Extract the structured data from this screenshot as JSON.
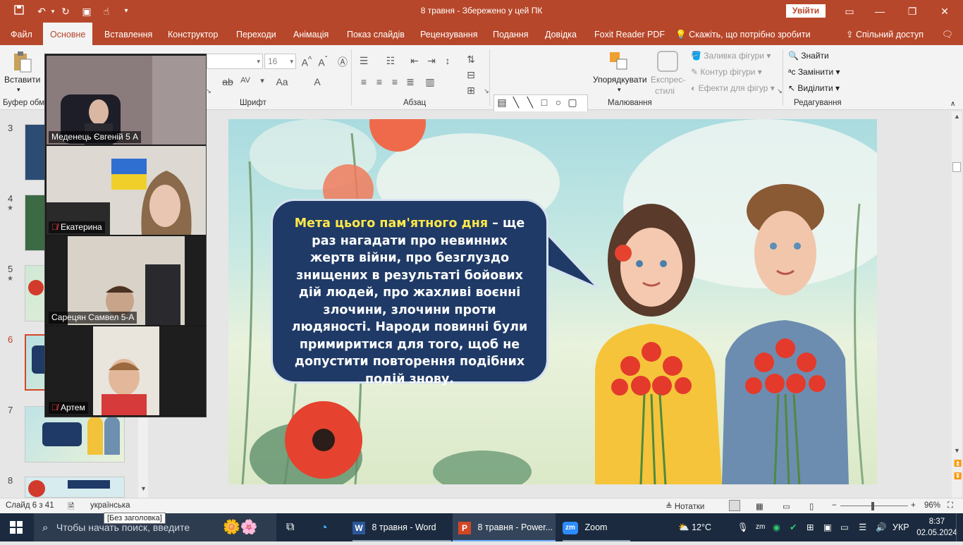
{
  "titlebar": {
    "doc_title": "8 травня  -  Збережено у цей ПК",
    "sign_in": "Увійти",
    "icons": [
      "save-icon",
      "undo-icon",
      "redo-icon",
      "present-icon",
      "touch-mode-icon",
      "customize-icon"
    ]
  },
  "tabs": [
    "Файл",
    "Основне",
    "Вставлення",
    "Конструктор",
    "Переходи",
    "Анімація",
    "Показ слайдів",
    "Рецензування",
    "Подання",
    "Довідка",
    "Foxit Reader PDF"
  ],
  "tell_me": "Скажіть, що потрібно зробити",
  "share": "Спільний доступ",
  "ribbon": {
    "paste": "Вставити",
    "clipboard_group": "Буфер обм",
    "font_size": "16",
    "font_group": "Шрифт",
    "paragraph_group": "Абзац",
    "arrange": "Упорядкувати",
    "quick_styles_1": "Експрес-",
    "quick_styles_2": "стилі",
    "shape_fill": "Заливка фігури",
    "shape_outline": "Контур фігури",
    "shape_effects": "Ефекти для фігур",
    "drawing_group": "Малювання",
    "find": "Знайти",
    "replace": "Замінити",
    "select": "Виділити",
    "editing_group": "Редагування"
  },
  "thumbnails": [
    {
      "num": "3",
      "star": ""
    },
    {
      "num": "4",
      "star": "★"
    },
    {
      "num": "5",
      "star": "★"
    },
    {
      "num": "6",
      "star": ""
    },
    {
      "num": "7",
      "star": ""
    },
    {
      "num": "8",
      "star": ""
    }
  ],
  "slide": {
    "highlight": "Мета цього пам'ятного дня",
    "text": " – ще раз нагадати про невинних жертв війни, про безглуздо знищених в результаті бойових дій людей, про жахливі воєнні злочини, злочини проти людяності. Народи повинні були примиритися для того, щоб не допустити повторення подібних подій знову."
  },
  "zoom": {
    "participants": [
      {
        "name": "Меденець Євгеній 5 А",
        "muted": false
      },
      {
        "name": "Екатерина",
        "muted": true
      },
      {
        "name": "Сарецян Самвел 5-А",
        "muted": false
      },
      {
        "name": "Артем",
        "muted": true
      }
    ]
  },
  "status": {
    "slide_info": "Слайд 6 з 41",
    "language": "українська",
    "notes": "Нотатки",
    "zoom_level": "96%",
    "tooltip": "[Без заголовка]"
  },
  "taskbar": {
    "search_placeholder": "Чтобы начать поиск, введите",
    "word": "8 травня - Word",
    "powerpoint": "8 травня - Power...",
    "zoom": "Zoom",
    "temp": "12°C",
    "lang": "УКР",
    "time": "8:37",
    "date": "02.05.2024"
  },
  "colors": {
    "accent": "#b7472a",
    "bubble": "#1f3a66",
    "highlight": "#ffe84a",
    "taskbar": "#1b2a3e"
  }
}
